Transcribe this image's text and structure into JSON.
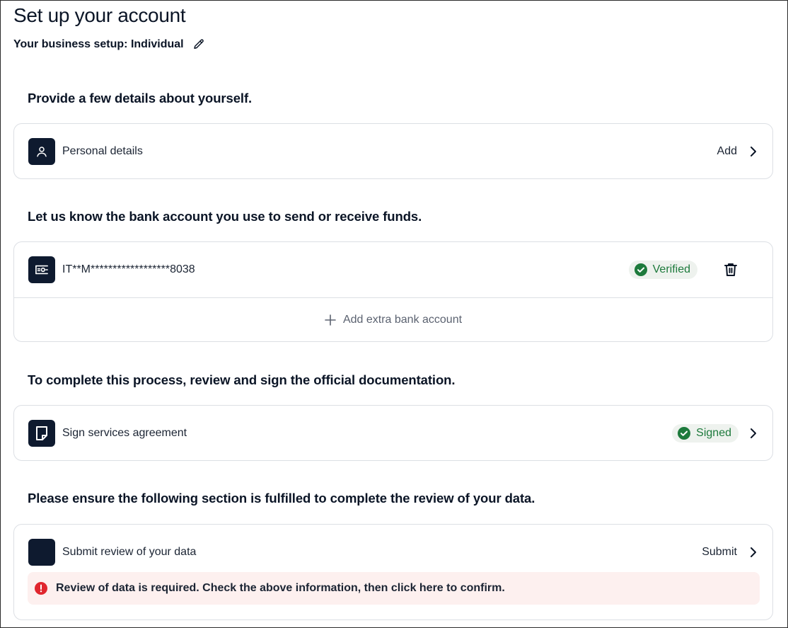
{
  "page": {
    "title": "Set up your account",
    "business_setup": "Your business setup: Individual"
  },
  "sections": {
    "personal": {
      "heading": "Provide a few details about yourself.",
      "label": "Personal details",
      "action": "Add"
    },
    "bank": {
      "heading": "Let us know the bank account you use to send or receive funds.",
      "account": "IT**M******************8038",
      "status": "Verified",
      "add_extra": "Add extra bank account"
    },
    "agreement": {
      "heading": "To complete this process, review and sign the official documentation.",
      "label": "Sign services agreement",
      "status": "Signed"
    },
    "review": {
      "heading": "Please ensure the following section is fulfilled to complete the review of your data.",
      "label": "Submit review of your data",
      "action": "Submit",
      "alert": "Review of data is required. Check the above information, then click here to confirm."
    }
  },
  "colors": {
    "icon_bg": "#0e1a2f",
    "success": "#1d7a3c",
    "error": "#e0262e",
    "alert_bg": "#fdf0ef"
  },
  "icons": [
    "pencil-icon",
    "user-icon",
    "chevron-right-icon",
    "bank-icon",
    "check-circle-icon",
    "trash-icon",
    "plus-icon",
    "document-icon",
    "error-icon"
  ]
}
